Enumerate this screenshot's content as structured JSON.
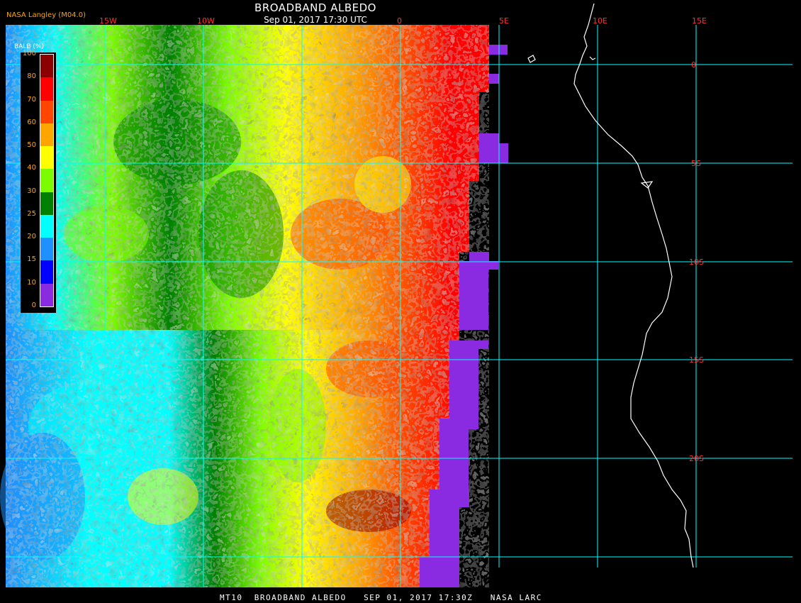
{
  "title": "BROADBAND ALBEDO",
  "subtitle": "Sep 01, 2017 17:30 UTC",
  "credit": "NASA Langley (M04.0)",
  "footer": "MT10  BROADBAND ALBEDO   SEP 01, 2017 17:30Z   NASA LARC",
  "legend": {
    "title": "BALB (%)",
    "labels": [
      "0",
      "10",
      "15",
      "20",
      "25",
      "30",
      "40",
      "50",
      "60",
      "70",
      "80",
      "100"
    ],
    "colors": [
      "#8a2be2",
      "#0000ff",
      "#1e90ff",
      "#00ffff",
      "#008000",
      "#7cfc00",
      "#ffff00",
      "#ffa500",
      "#ff4500",
      "#ff0000",
      "#8b0000"
    ]
  },
  "lon_labels": [
    "15W",
    "10W",
    "0",
    "5E",
    "10E",
    "15E"
  ],
  "lat_labels": [
    "0",
    "5S",
    "10S",
    "15S",
    "20S"
  ],
  "colors": {
    "grid": "#00ffff",
    "coast": "#ffffff",
    "tick_label": "#ff3030",
    "background": "#000000",
    "nodata": "#8a2be2"
  }
}
